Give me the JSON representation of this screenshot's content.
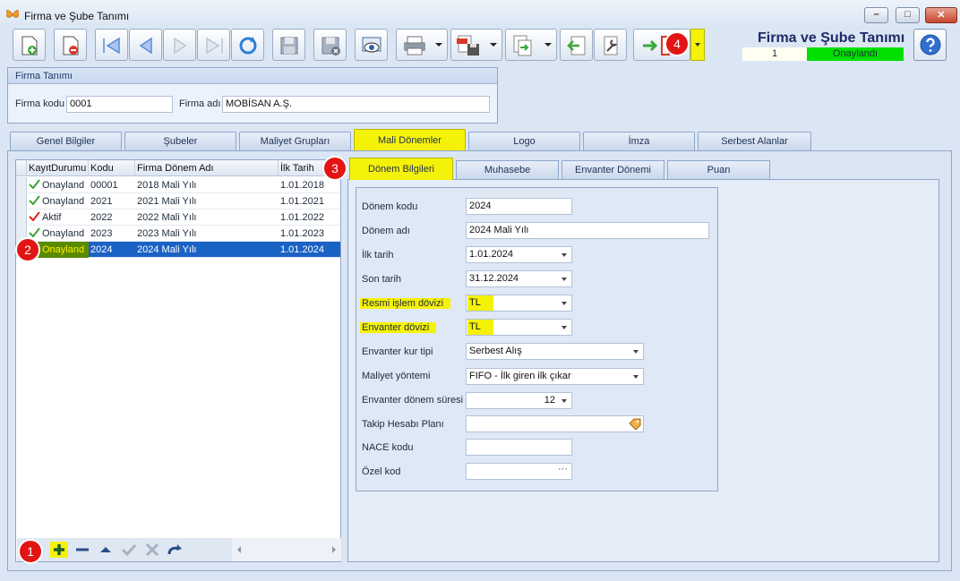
{
  "window": {
    "title": "Firma ve Şube Tanımı",
    "minimize": "–",
    "maximize": "□",
    "close": "✕"
  },
  "header": {
    "form_title": "Firma ve Şube Tanımı",
    "record_no": "1",
    "status": "Onaylandı"
  },
  "badges": {
    "b1": "1",
    "b2": "2",
    "b3": "3",
    "b4": "4"
  },
  "toolbar": {
    "icons": [
      "new-record-icon",
      "delete-record-icon",
      "first-record-icon",
      "prev-record-icon",
      "next-record-icon",
      "last-record-icon",
      "refresh-icon",
      "save-icon",
      "save-cancel-icon",
      "preview-icon",
      "print-icon",
      "pdf-save-icon",
      "export-icon",
      "import-icon",
      "tools-icon",
      "exit-icon",
      "help-icon"
    ]
  },
  "firma": {
    "section_title": "Firma Tanımı",
    "code_label": "Firma kodu",
    "code_value": "0001",
    "name_label": "Firma adı",
    "name_value": "MOBİSAN A.Ş."
  },
  "tabs": [
    "Genel Bilgiler",
    "Şubeler",
    "Maliyet Grupları",
    "Mali Dönemler",
    "Logo",
    "İmza",
    "Serbest Alanlar"
  ],
  "active_tab": "Mali Dönemler",
  "grid": {
    "columns": [
      "KayıtDurumu",
      "Kodu",
      "Firma Dönem Adı",
      "İlk Tarih"
    ],
    "rows": [
      {
        "status": "Onayland",
        "code": "00001",
        "name": "2018 Mali Yılı",
        "date": "1.01.2018",
        "check_color": "#3aa23a"
      },
      {
        "status": "Onayland",
        "code": "2021",
        "name": "2021 Mali Yılı",
        "date": "1.01.2021",
        "check_color": "#3aa23a"
      },
      {
        "status": "Aktif",
        "code": "2022",
        "name": "2022 Mali Yılı",
        "date": "1.01.2022",
        "check_color": "#e02020"
      },
      {
        "status": "Onayland",
        "code": "2023",
        "name": "2023 Mali Yılı",
        "date": "1.01.2023",
        "check_color": "#3aa23a"
      },
      {
        "status": "Onayland",
        "code": "2024",
        "name": "2024 Mali Yılı",
        "date": "1.01.2024",
        "check_color": "#3aa23a"
      }
    ],
    "selected_index": 4,
    "nav_icons": [
      "add-row-icon",
      "remove-row-icon",
      "move-up-icon",
      "confirm-icon",
      "cancel-icon",
      "redo-icon"
    ]
  },
  "subtabs": [
    "Dönem Bilgileri",
    "Muhasebe",
    "Envanter Dönemi",
    "Puan"
  ],
  "active_subtab": "Dönem Bilgileri",
  "donem": {
    "kod_label": "Dönem kodu",
    "kod_value": "2024",
    "ad_label": "Dönem adı",
    "ad_value": "2024 Mali Yılı",
    "ilk_label": "İlk tarih",
    "ilk_value": "1.01.2024",
    "son_label": "Son tarih",
    "son_value": "31.12.2024",
    "resmi_label": "Resmi işlem dövizi",
    "resmi_value": "TL",
    "envdoviz_label": "Envanter dövizi",
    "envdoviz_value": "TL",
    "kurtipi_label": "Envanter kur tipi",
    "kurtipi_value": "Serbest Alış",
    "maliyet_label": "Maliyet yöntemi",
    "maliyet_value": "FIFO - İlk giren ilk çıkar",
    "sure_label": "Envanter dönem süresi",
    "sure_value": "12",
    "takip_label": "Takip Hesabı Planı",
    "takip_value": "",
    "nace_label": "NACE kodu",
    "nace_value": "",
    "ozel_label": "Özel kod",
    "ozel_value": "",
    "ellipsis": "···"
  },
  "colors": {
    "highlight": "#f5f20a",
    "status_ok": "#00e000",
    "badge": "#e31414",
    "selection": "#1a62c4"
  }
}
